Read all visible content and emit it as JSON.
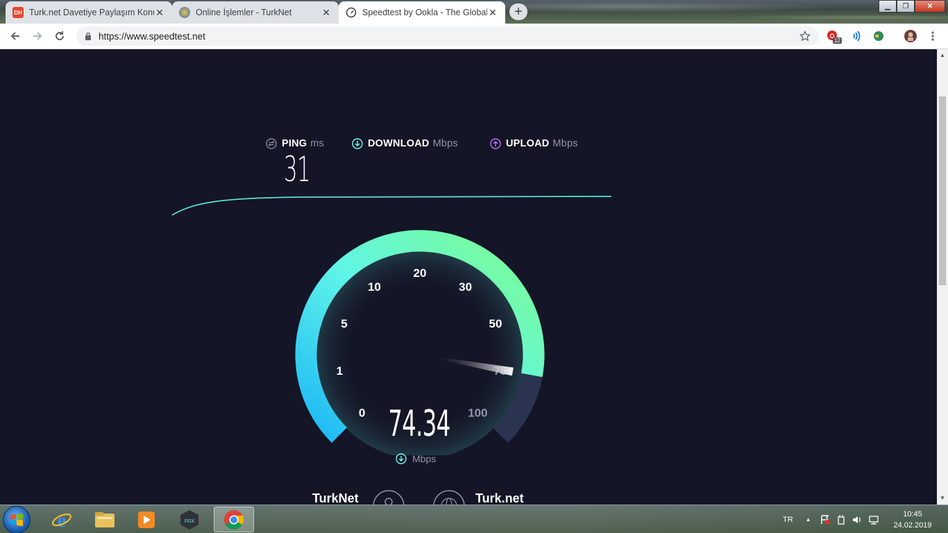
{
  "browser": {
    "tabs": [
      {
        "title": "Turk.net Davetiye Paylaşım Konu",
        "favicon": "DH",
        "active": false
      },
      {
        "title": "Online İşlemler - TurkNet",
        "favicon": "globe",
        "active": false
      },
      {
        "title": "Speedtest by Ookla - The Global",
        "favicon": "speedtest",
        "active": true
      }
    ],
    "new_tab_icon": "+",
    "url": "https://www.speedtest.net",
    "extension_badge": "12"
  },
  "speedtest": {
    "ping": {
      "label": "PING",
      "unit": "ms",
      "value": "31"
    },
    "download": {
      "label": "DOWNLOAD",
      "unit": "Mbps"
    },
    "upload": {
      "label": "UPLOAD",
      "unit": "Mbps"
    },
    "gauge": {
      "ticks": [
        "0",
        "1",
        "5",
        "10",
        "20",
        "30",
        "50",
        "75",
        "100"
      ],
      "current_value": "74.34",
      "unit": "Mbps",
      "colors": {
        "start": "#1cb6f5",
        "end": "#7dfc8c",
        "track": "#2a3450",
        "needle": "#ffffff"
      }
    },
    "isp": {
      "provider": "TurkNet",
      "server": "Turk.net"
    }
  },
  "taskbar": {
    "language": "TR",
    "time": "10:45",
    "date": "24.02.2019"
  }
}
